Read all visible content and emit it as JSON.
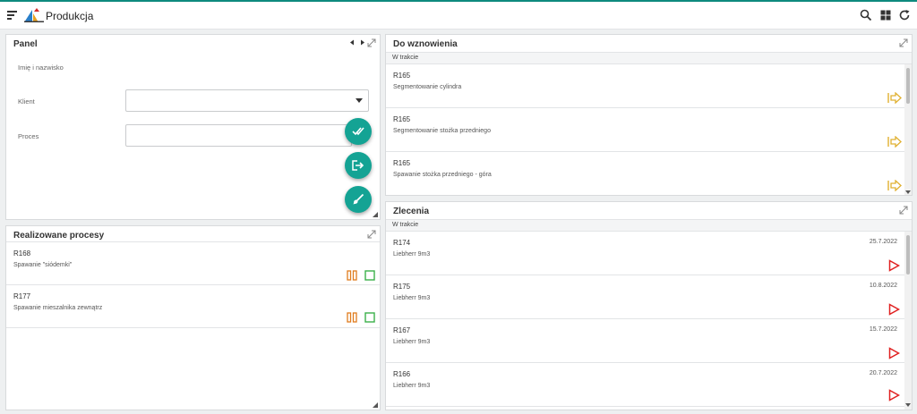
{
  "app": {
    "title": "Produkcja"
  },
  "colors": {
    "accent": "#14a394",
    "resume_arrow": "#e0b030",
    "pause": "#e07c1e",
    "stop": "#3bb04a",
    "play": "#e02020"
  },
  "panel": {
    "title": "Panel",
    "fields": [
      {
        "label": "Imię i nazwisko"
      },
      {
        "label": "Klient",
        "value": ""
      },
      {
        "label": "Proces",
        "value": ""
      }
    ],
    "fabs": [
      "check-all-icon",
      "exit-icon",
      "brush-icon"
    ]
  },
  "realizowane": {
    "title": "Realizowane procesy",
    "items": [
      {
        "code": "R168",
        "desc": "Spawanie \"siódemki\""
      },
      {
        "code": "R177",
        "desc": "Spawanie mieszalnika zewnątrz"
      }
    ]
  },
  "do_wznowienia": {
    "title": "Do wznowienia",
    "subheader": "W trakcie",
    "items": [
      {
        "code": "R165",
        "desc": "Segmentowanie cylindra"
      },
      {
        "code": "R165",
        "desc": "Segmentowanie stożka przedniego"
      },
      {
        "code": "R165",
        "desc": "Spawanie stożka przedniego - góra"
      }
    ]
  },
  "zlecenia": {
    "title": "Zlecenia",
    "subheader": "W trakcie",
    "items": [
      {
        "code": "R174",
        "desc": "Liebherr 9m3",
        "date": "25.7.2022"
      },
      {
        "code": "R175",
        "desc": "Liebherr 9m3",
        "date": "10.8.2022"
      },
      {
        "code": "R167",
        "desc": "Liebherr 9m3",
        "date": "15.7.2022"
      },
      {
        "code": "R166",
        "desc": "Liebherr 9m3",
        "date": "20.7.2022"
      }
    ]
  }
}
